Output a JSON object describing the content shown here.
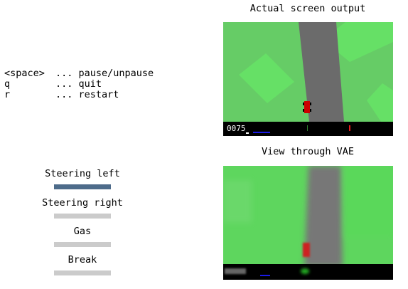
{
  "help": {
    "rows": [
      {
        "key": "<space>",
        "action": "... pause/unpause"
      },
      {
        "key": "q",
        "action": "... quit"
      },
      {
        "key": "r",
        "action": "... restart"
      }
    ]
  },
  "controls": {
    "steering_left": {
      "label": "Steering left",
      "level": 1.0
    },
    "steering_right": {
      "label": "Steering right",
      "level": 0.0
    },
    "gas": {
      "label": "Gas",
      "level": 0.0
    },
    "brake": {
      "label": "Break",
      "level": 0.0
    }
  },
  "panels": {
    "actual": {
      "title": "Actual screen output",
      "score": "0075"
    },
    "vae": {
      "title": "View through VAE"
    }
  },
  "colors": {
    "grass": "#66cc66",
    "grass_light": "#66e066",
    "road": "#6b6b6b",
    "car": "#cc0000",
    "hud": "#000000",
    "bar_active": "#4d6b8a",
    "bar_inactive": "#cbcbcb"
  }
}
